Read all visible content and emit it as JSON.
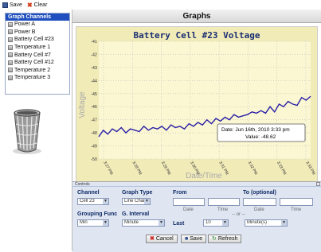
{
  "toolbar": {
    "save_label": "Save",
    "clear_label": "Clear"
  },
  "sidebar": {
    "header": "Graph Channels",
    "items": [
      {
        "label": "Power A"
      },
      {
        "label": "Power B"
      },
      {
        "label": "Battery Cell #23"
      },
      {
        "label": "Temperature 1"
      },
      {
        "label": "Battery Cell #7"
      },
      {
        "label": "Battery Cell #12"
      },
      {
        "label": "Temperature 2"
      },
      {
        "label": "Temperature 3"
      }
    ]
  },
  "main": {
    "title": "Graphs"
  },
  "chart_data": {
    "type": "line",
    "title": "Battery Cell #23 Voltage",
    "xlabel": "Date/Time",
    "ylabel": "Voltage",
    "ylim": [
      -50,
      -41
    ],
    "y_ticks": [
      "-41",
      "-42",
      "-43",
      "-44",
      "-45",
      "-46",
      "-47",
      "-48",
      "-49",
      "-50"
    ],
    "x_ticks": [
      "3:27 PM",
      "3:28 PM",
      "3:29 PM",
      "3:30 PM",
      "3:31 PM",
      "3:32 PM",
      "3:33 PM",
      "3:33 PM"
    ],
    "series": [
      {
        "values": [
          -48.3,
          -47.8,
          -48.1,
          -47.7,
          -47.9,
          -47.6,
          -48.0,
          -47.7,
          -47.8,
          -47.9,
          -47.5,
          -47.8,
          -47.6,
          -47.7,
          -47.5,
          -47.8,
          -47.4,
          -47.6,
          -47.5,
          -47.7,
          -47.3,
          -47.5,
          -47.2,
          -47.4,
          -47.0,
          -47.3,
          -46.9,
          -47.1,
          -46.8,
          -47.0,
          -46.6,
          -46.8,
          -46.7,
          -46.6,
          -46.4,
          -46.5,
          -46.3,
          -46.5,
          -46.0,
          -46.4,
          -45.8,
          -46.0,
          -45.6,
          -45.8,
          -45.9,
          -45.3,
          -45.5,
          -45.2
        ]
      }
    ],
    "tooltip": {
      "line1": "Date: Jun 16th, 2010 3:33 pm",
      "line2": "Value: -48.62"
    },
    "colors": {
      "line": "#2a1fa8",
      "plot_bg": "#fbf7d2",
      "frame_bg": "#f1ebb8",
      "title": "#1c2f73",
      "axis_label": "#a9a9a9"
    }
  },
  "controls": {
    "header": "Controls",
    "channel": {
      "label": "Channel",
      "value": "Cell 23"
    },
    "graph_type": {
      "label": "Graph Type",
      "value": "Line Chart"
    },
    "from": {
      "label": "From",
      "date_sub": "Date",
      "time_sub": "Time"
    },
    "to": {
      "label": "To (optional)",
      "date_sub": "Date",
      "time_sub": "Time"
    },
    "grouping": {
      "label": "Grouping Func",
      "value": "Min"
    },
    "interval": {
      "label": "G. Interval",
      "value": "Minute"
    },
    "or_text": "-- or --",
    "last": {
      "label": "Last",
      "value": "10",
      "unit": "Minute(s)"
    },
    "buttons": {
      "cancel": "Cancel",
      "save": "Save",
      "refresh": "Refresh"
    }
  }
}
